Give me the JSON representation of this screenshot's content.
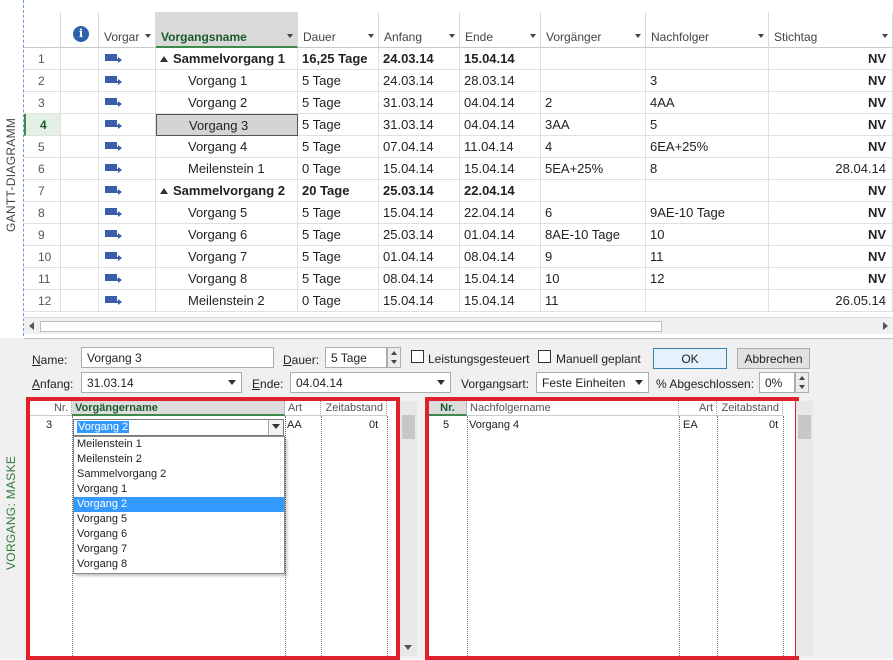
{
  "side_labels": {
    "gantt": "GANTT-DIAGRAMM",
    "form": "VORGANG: MASKE"
  },
  "table": {
    "columns": {
      "indicators": "info-icon",
      "mode": "Vorgar",
      "name": "Vorgangsname",
      "duration": "Dauer",
      "start": "Anfang",
      "finish": "Ende",
      "predecessors": "Vorgänger",
      "successors": "Nachfolger",
      "deadline": "Stichtag"
    },
    "rows": [
      {
        "id": "1",
        "summary": true,
        "name": "Sammelvorgang 1",
        "duration": "16,25 Tage",
        "start": "24.03.14",
        "finish": "15.04.14",
        "predecessors": "",
        "successors": "",
        "deadline": "NV"
      },
      {
        "id": "2",
        "summary": false,
        "name": "Vorgang 1",
        "duration": "5 Tage",
        "start": "24.03.14",
        "finish": "28.03.14",
        "predecessors": "",
        "successors": "3",
        "deadline": "NV"
      },
      {
        "id": "3",
        "summary": false,
        "name": "Vorgang 2",
        "duration": "5 Tage",
        "start": "31.03.14",
        "finish": "04.04.14",
        "predecessors": "2",
        "successors": "4AA",
        "deadline": "NV"
      },
      {
        "id": "4",
        "summary": false,
        "selected": true,
        "name": "Vorgang 3",
        "duration": "5 Tage",
        "start": "31.03.14",
        "finish": "04.04.14",
        "predecessors": "3AA",
        "successors": "5",
        "deadline": "NV"
      },
      {
        "id": "5",
        "summary": false,
        "name": "Vorgang 4",
        "duration": "5 Tage",
        "start": "07.04.14",
        "finish": "11.04.14",
        "predecessors": "4",
        "successors": "6EA+25%",
        "deadline": "NV"
      },
      {
        "id": "6",
        "summary": false,
        "name": "Meilenstein 1",
        "duration": "0 Tage",
        "start": "15.04.14",
        "finish": "15.04.14",
        "predecessors": "5EA+25%",
        "successors": "8",
        "deadline": "28.04.14"
      },
      {
        "id": "7",
        "summary": true,
        "name": "Sammelvorgang 2",
        "duration": "20 Tage",
        "start": "25.03.14",
        "finish": "22.04.14",
        "predecessors": "",
        "successors": "",
        "deadline": "NV"
      },
      {
        "id": "8",
        "summary": false,
        "name": "Vorgang 5",
        "duration": "5 Tage",
        "start": "15.04.14",
        "finish": "22.04.14",
        "predecessors": "6",
        "successors": "9AE-10 Tage",
        "deadline": "NV"
      },
      {
        "id": "9",
        "summary": false,
        "name": "Vorgang 6",
        "duration": "5 Tage",
        "start": "25.03.14",
        "finish": "01.04.14",
        "predecessors": "8AE-10 Tage",
        "successors": "10",
        "deadline": "NV"
      },
      {
        "id": "10",
        "summary": false,
        "name": "Vorgang 7",
        "duration": "5 Tage",
        "start": "01.04.14",
        "finish": "08.04.14",
        "predecessors": "9",
        "successors": "11",
        "deadline": "NV"
      },
      {
        "id": "11",
        "summary": false,
        "name": "Vorgang 8",
        "duration": "5 Tage",
        "start": "08.04.14",
        "finish": "15.04.14",
        "predecessors": "10",
        "successors": "12",
        "deadline": "NV"
      },
      {
        "id": "12",
        "summary": false,
        "name": "Meilenstein 2",
        "duration": "0 Tage",
        "start": "15.04.14",
        "finish": "15.04.14",
        "predecessors": "11",
        "successors": "",
        "deadline": "26.05.14"
      }
    ]
  },
  "form": {
    "name_label": "Name:",
    "name_value": "Vorgang 3",
    "duration_label": "Dauer:",
    "duration_value": "5 Tage",
    "effort_driven_label": "Leistungsgesteuert",
    "manual_label": "Manuell geplant",
    "ok_label": "OK",
    "cancel_label": "Abbrechen",
    "start_label": "Anfang:",
    "start_value": "31.03.14",
    "finish_label": "Ende:",
    "finish_value": "04.04.14",
    "task_type_label": "Vorgangsart:",
    "task_type_value": "Feste Einheiten",
    "pct_label": "% Abgeschlossen:",
    "pct_value": "0%"
  },
  "predecessors_table": {
    "headers": {
      "nr": "Nr.",
      "name": "Vorgängername",
      "type": "Art",
      "lag": "Zeitabstand"
    },
    "row": {
      "nr": "3",
      "name": "Vorgang 2",
      "type": "AA",
      "lag": "0t"
    },
    "dropdown_options": [
      "Meilenstein 1",
      "Meilenstein 2",
      "Sammelvorgang 2",
      "Vorgang 1",
      "Vorgang 2",
      "Vorgang 5",
      "Vorgang 6",
      "Vorgang 7",
      "Vorgang 8"
    ],
    "dropdown_selected": "Vorgang 2"
  },
  "successors_table": {
    "headers": {
      "nr": "Nr.",
      "name": "Nachfolgername",
      "type": "Art",
      "lag": "Zeitabstand"
    },
    "row": {
      "nr": "5",
      "name": "Vorgang 4",
      "type": "EA",
      "lag": "0t"
    }
  },
  "colors": {
    "highlight_border": "#e0202a",
    "selection_green": "#3d8a4a",
    "list_highlight": "#3399ff"
  }
}
